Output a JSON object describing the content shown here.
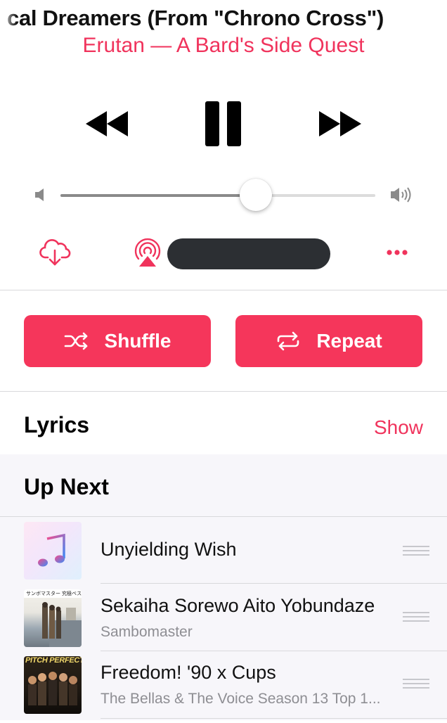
{
  "now_playing": {
    "title": "cal Dreamers (From \"Chrono Cross\")",
    "subtitle": "Erutan — A Bard's Side Quest"
  },
  "transport": {
    "previous_icon": "rewind-icon",
    "play_pause_icon": "pause-icon",
    "next_icon": "fast-forward-icon"
  },
  "volume": {
    "level": 0.62,
    "min_icon": "speaker-low-icon",
    "max_icon": "speaker-high-icon"
  },
  "actions": {
    "download_icon": "cloud-download-icon",
    "airplay_icon": "airplay-icon",
    "more_icon": "more-icon"
  },
  "buttons": {
    "shuffle_label": "Shuffle",
    "repeat_label": "Repeat"
  },
  "lyrics": {
    "heading": "Lyrics",
    "show_label": "Show"
  },
  "up_next": {
    "heading": "Up Next",
    "items": [
      {
        "title": "Unyielding Wish",
        "artist": ""
      },
      {
        "title": "Sekaiha Sorewo Aito Yobundaze",
        "artist": "Sambomaster"
      },
      {
        "title": "Freedom! '90 x Cups",
        "artist": "The Bellas & The Voice Season 13 Top 1..."
      }
    ],
    "art2_caption": "サンボマスター 究極ベスト",
    "art3_caption": "PITCH PERFECT 3"
  },
  "colors": {
    "accent": "#f0335c",
    "button": "#f5365b",
    "airplay_pill": "#2c2f33"
  }
}
